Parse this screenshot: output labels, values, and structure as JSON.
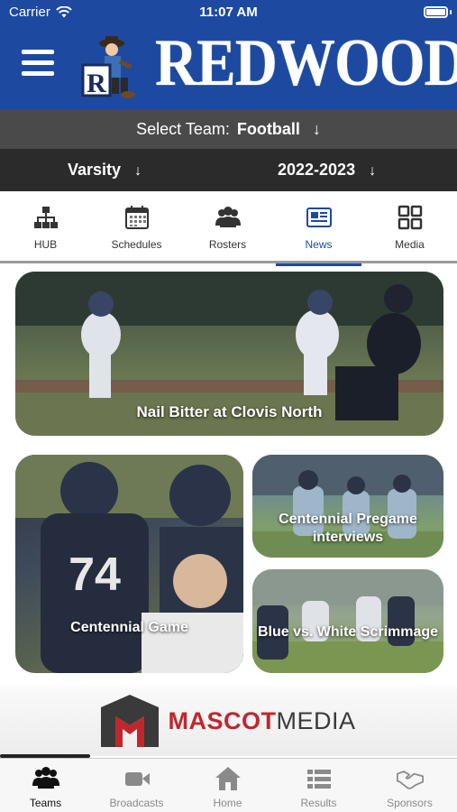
{
  "status_bar": {
    "carrier": "Carrier",
    "time": "11:07 AM"
  },
  "header": {
    "brand": "REDWOOD",
    "mascot_letter": "R"
  },
  "team_selector": {
    "label": "Select Team:",
    "value": "Football",
    "arrow": "↓"
  },
  "filters": {
    "level": "Varsity",
    "season": "2022-2023",
    "arrow": "↓"
  },
  "tabs": [
    {
      "label": "HUB",
      "icon": "hierarchy-icon"
    },
    {
      "label": "Schedules",
      "icon": "calendar-icon"
    },
    {
      "label": "Rosters",
      "icon": "users-icon"
    },
    {
      "label": "News",
      "icon": "newspaper-icon",
      "active": true
    },
    {
      "label": "Media",
      "icon": "grid-icon"
    }
  ],
  "news": [
    {
      "title": "Nail Bitter at Clovis North"
    },
    {
      "title": "Centennial Game"
    },
    {
      "title": "Centennial Pregame interviews"
    },
    {
      "title": "Blue vs. White Scrimmage"
    }
  ],
  "sponsor": {
    "name_part1": "MASCOT",
    "name_part2": "MEDIA"
  },
  "bottom_nav": [
    {
      "label": "Teams",
      "icon": "team-icon",
      "active": true
    },
    {
      "label": "Broadcasts",
      "icon": "video-camera-icon"
    },
    {
      "label": "Home",
      "icon": "home-icon"
    },
    {
      "label": "Results",
      "icon": "list-icon"
    },
    {
      "label": "Sponsors",
      "icon": "handshake-icon"
    }
  ],
  "colors": {
    "brand_blue": "#1d4aa0",
    "team_bar": "#4a4a4a",
    "filter_bar": "#2b2b2b",
    "sponsor_red": "#c0272d"
  }
}
